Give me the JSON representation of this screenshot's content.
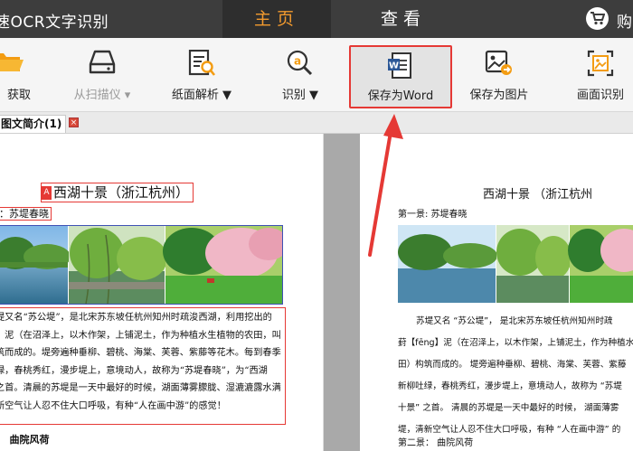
{
  "titlebar": {
    "app_title": "速OCR文字识别",
    "tabs": [
      {
        "label": "主页",
        "active": true
      },
      {
        "label": "查看",
        "active": false
      }
    ],
    "cart_label": "购",
    "accent": "#f29a2e"
  },
  "toolbar": {
    "items": [
      {
        "label": "获取",
        "icon": "folder-icon"
      },
      {
        "label": "从扫描仪 ▾",
        "icon": "scanner-icon",
        "disabled": true
      },
      {
        "label": "纸面解析 ▼",
        "icon": "page-analyze-icon"
      },
      {
        "label": "识别 ▼",
        "icon": "ocr-recognize-icon"
      },
      {
        "label": "保存为Word",
        "icon": "word-document-icon",
        "highlighted": true
      },
      {
        "label": "保存为图片",
        "icon": "save-image-icon"
      },
      {
        "label": "画面识别",
        "icon": "screen-capture-icon"
      }
    ]
  },
  "doc_tab": {
    "label": "图文简介(1)",
    "close_label": "×"
  },
  "left_pane": {
    "badge": "A",
    "title": "西湖十景（浙江杭州）",
    "subtitle": "：苏堤春晓",
    "paragraph_lines": [
      "堤又名“苏公堤”，是北宋苏东坡任杭州知州时疏浚西湖，利用挖出的",
      "】泥（在沼泽上，以木作架，上铺泥土，作为种植水生植物的农田，叫葑",
      "筑而成的。堤旁遍种垂柳、碧桃、海棠、芙蓉、紫藤等花木。每到春季，",
      "绿，春桃秀红，漫步堤上，意境动人，故称为“苏堤春晓”，为“西湖",
      "之首。清晨的苏堤是一天中最好的时候，湖面薄雾朦胧、湿漉漉露水满",
      "新空气让人忍不住大口呼吸，有种“人在画中游”的感觉！"
    ],
    "next_num": "：",
    "next_label": "曲院风荷"
  },
  "right_pane": {
    "title": "西湖十景 （浙江杭州",
    "subtitle": "第一景:  苏堤春晓",
    "paragraph_lines": [
      "苏堤又名 “苏公堤”， 是北宋苏东坡任杭州知州时疏",
      "葑【fēng】泥（在沼泽上，以木作架，上铺泥土，作为种植水生",
      "田）构筑而成的。 堤旁遍种垂柳、碧桃、海棠、芙蓉、紫藤",
      "新柳吐绿，春桃秀红，漫步堤上，意境动人，故称为 “苏堤",
      "十景” 之首。 清晨的苏堤是一天中最好的时候， 湖面薄雾",
      "堤，清新空气让人忍不住大口呼吸，有种 “人在画中游” 的"
    ],
    "next": "第二景：  曲院风荷"
  },
  "annotation_color": "#e53935"
}
